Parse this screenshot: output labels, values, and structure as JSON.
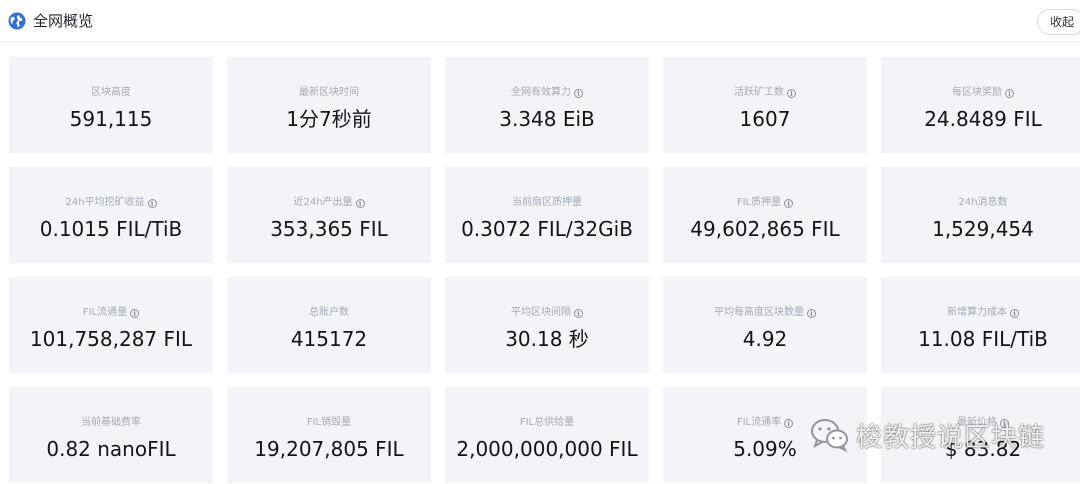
{
  "header": {
    "title": "全网概览",
    "collapse_label": "收起"
  },
  "cards": [
    {
      "label": "区块高度",
      "value": "591,115",
      "info": false
    },
    {
      "label": "最新区块时间",
      "value": "1分7秒前",
      "info": false
    },
    {
      "label": "全网有效算力",
      "value": "3.348 EiB",
      "info": true
    },
    {
      "label": "活跃矿工数",
      "value": "1607",
      "info": true
    },
    {
      "label": "每区块奖励",
      "value": "24.8489 FIL",
      "info": true
    },
    {
      "label": "24h平均挖矿收益",
      "value": "0.1015 FIL/TiB",
      "info": true
    },
    {
      "label": "近24h产出量",
      "value": "353,365 FIL",
      "info": true
    },
    {
      "label": "当前扇区质押量",
      "value": "0.3072 FIL/32GiB",
      "info": false
    },
    {
      "label": "FIL质押量",
      "value": "49,602,865 FIL",
      "info": true
    },
    {
      "label": "24h消息数",
      "value": "1,529,454",
      "info": false
    },
    {
      "label": "FIL流通量",
      "value": "101,758,287 FIL",
      "info": true
    },
    {
      "label": "总账户数",
      "value": "415172",
      "info": false
    },
    {
      "label": "平均区块间隔",
      "value": "30.18 秒",
      "info": true
    },
    {
      "label": "平均每高度区块数量",
      "value": "4.92",
      "info": true
    },
    {
      "label": "新增算力成本",
      "value": "11.08 FIL/TiB",
      "info": true
    },
    {
      "label": "当前基础费率",
      "value": "0.82 nanoFIL",
      "info": false
    },
    {
      "label": "FIL销毁量",
      "value": "19,207,805 FIL",
      "info": false
    },
    {
      "label": "FIL总供给量",
      "value": "2,000,000,000 FIL",
      "info": false
    },
    {
      "label": "FIL流通率",
      "value": "5.09%",
      "info": true
    },
    {
      "label": "最新价格",
      "value": "$ 83.82",
      "info": true
    }
  ],
  "info_glyph": "i",
  "watermark": {
    "text": "梭教授说区块链",
    "icon": "wechat-icon"
  },
  "colors": {
    "card_bg": "#f2f4f7",
    "label": "#a5abb5",
    "value": "#111418",
    "globe": "#2f6fd6"
  }
}
